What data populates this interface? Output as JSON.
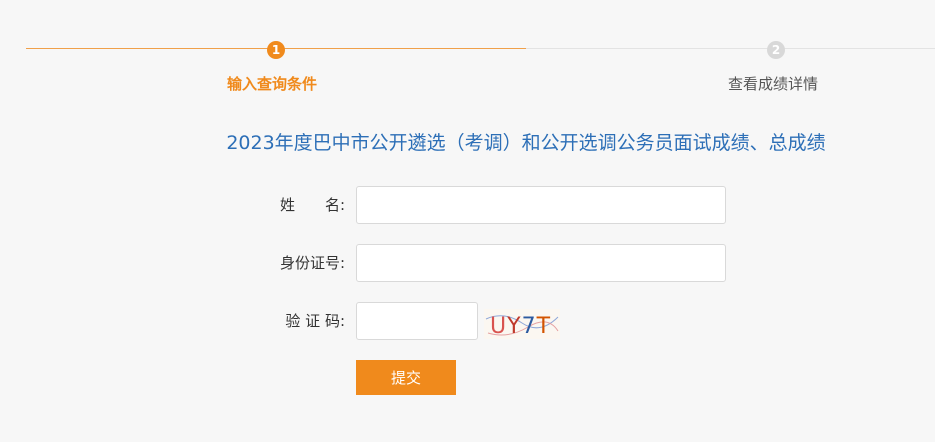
{
  "steps": [
    {
      "number": "1",
      "label": "输入查询条件",
      "active": true
    },
    {
      "number": "2",
      "label": "查看成绩详情",
      "active": false
    }
  ],
  "title": "2023年度巴中市公开遴选（考调）和公开选调公务员面试成绩、总成绩",
  "form": {
    "name_label": "姓　　名:",
    "name_value": "",
    "id_label": "身份证号:",
    "id_value": "",
    "captcha_label": "验 证 码:",
    "captcha_value": "",
    "captcha_image_text": "UY7T",
    "submit_label": "提交"
  },
  "colors": {
    "accent": "#f08a1c",
    "title": "#2d6fb7",
    "inactive": "#d8d8d8"
  }
}
